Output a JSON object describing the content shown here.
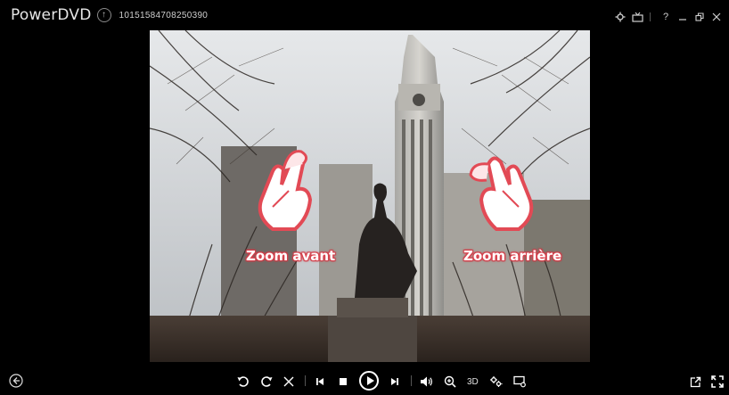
{
  "titlebar": {
    "app_title": "PowerDVD",
    "file_name": "10151584708250390",
    "controls": [
      "settings-icon",
      "tv-mode-icon",
      "help-icon",
      "minimize-icon",
      "restore-icon",
      "close-icon"
    ],
    "help_label": "?"
  },
  "viewer": {
    "zoom_in_label": "Zoom avant",
    "zoom_out_label": "Zoom arrière"
  },
  "controlbar": {
    "three_d_label": "3D",
    "buttons": [
      "back-icon",
      "rotate-left-icon",
      "rotate-right-icon",
      "delete-icon",
      "previous-icon",
      "stop-icon",
      "play-icon",
      "next-icon",
      "volume-icon",
      "zoom-icon",
      "3d-button",
      "settings-icon",
      "slideshow-icon",
      "popout-icon",
      "fullscreen-icon"
    ]
  },
  "colors": {
    "background": "#000000",
    "gesture_accent": "#e24a55"
  }
}
